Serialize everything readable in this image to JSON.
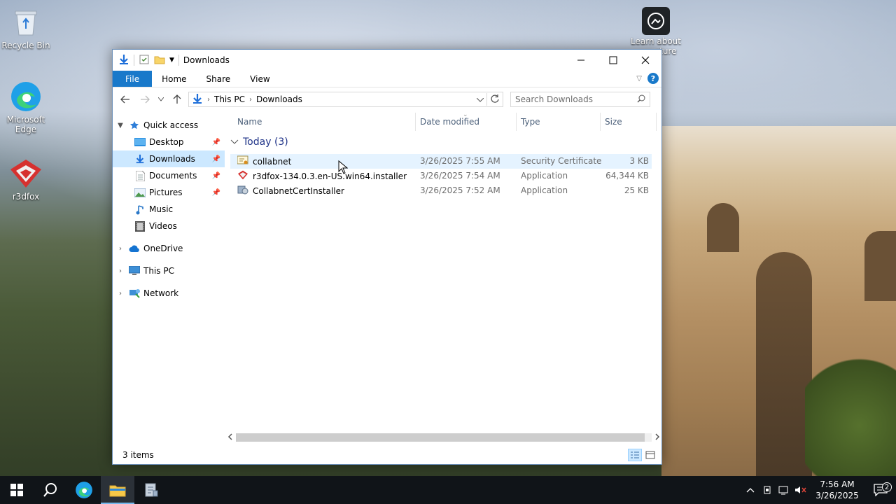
{
  "desktop": {
    "icons": [
      {
        "label": "Recycle Bin"
      },
      {
        "label": "Microsoft Edge"
      },
      {
        "label": "r3dfox"
      }
    ],
    "learn_line1": "Learn about",
    "learn_line2": "cture"
  },
  "window": {
    "title": "Downloads",
    "controls": {
      "minimize": "—",
      "maximize": "☐",
      "close": "✕"
    },
    "ribbon_tabs": [
      "File",
      "Home",
      "Share",
      "View"
    ],
    "help": "?",
    "address": {
      "crumbs": [
        "This PC",
        "Downloads"
      ]
    },
    "search_placeholder": "Search Downloads",
    "nav": {
      "quick_access": "Quick access",
      "items": [
        {
          "label": "Desktop",
          "pinned": true
        },
        {
          "label": "Downloads",
          "pinned": true,
          "selected": true
        },
        {
          "label": "Documents",
          "pinned": true
        },
        {
          "label": "Pictures",
          "pinned": true
        },
        {
          "label": "Music",
          "pinned": false
        },
        {
          "label": "Videos",
          "pinned": false
        }
      ],
      "onedrive": "OneDrive",
      "thispc": "This PC",
      "network": "Network"
    },
    "columns": {
      "name": "Name",
      "date": "Date modified",
      "type": "Type",
      "size": "Size"
    },
    "group": "Today (3)",
    "files": [
      {
        "name": "collabnet",
        "date": "3/26/2025 7:55 AM",
        "type": "Security Certificate",
        "size": "3 KB"
      },
      {
        "name": "r3dfox-134.0.3.en-US.win64.installer",
        "date": "3/26/2025 7:54 AM",
        "type": "Application",
        "size": "64,344 KB"
      },
      {
        "name": "CollabnetCertInstaller",
        "date": "3/26/2025 7:52 AM",
        "type": "Application",
        "size": "25 KB"
      }
    ],
    "status": "3 items"
  },
  "taskbar": {
    "time": "7:56 AM",
    "date": "3/26/2025",
    "notifications": "2"
  },
  "colors": {
    "accent": "#1979ca",
    "selection": "#cce8ff",
    "hover": "#e5f3ff",
    "taskbar": "#101418"
  }
}
